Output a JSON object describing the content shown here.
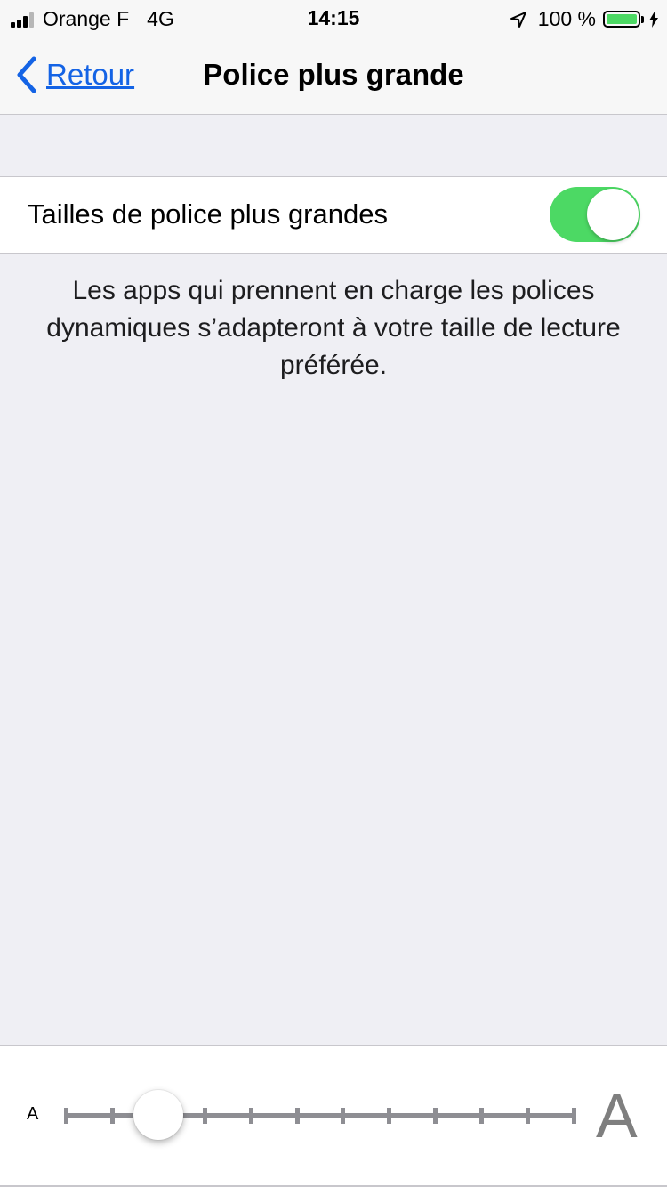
{
  "status_bar": {
    "carrier": "Orange F",
    "network": "4G",
    "time": "14:15",
    "battery_percent": "100 %",
    "battery_level": 1.0,
    "signal_bars_filled": 3,
    "signal_bars_total": 4,
    "icons": [
      "signal-icon",
      "location-arrow-icon",
      "battery-icon",
      "charging-bolt-icon"
    ]
  },
  "navbar": {
    "back_label": "Retour",
    "title": "Police plus grande",
    "accent_color": "#1463e5"
  },
  "settings": {
    "larger_text_label": "Tailles de police plus grandes",
    "larger_text_enabled": true,
    "toggle_on_color": "#4cd964",
    "footer": "Les apps qui prennent en charge les polices dynamiques s’adapteront à votre taille de lecture préférée."
  },
  "slider": {
    "min_label": "A",
    "max_label": "A",
    "steps": 12,
    "current_step": 2
  }
}
